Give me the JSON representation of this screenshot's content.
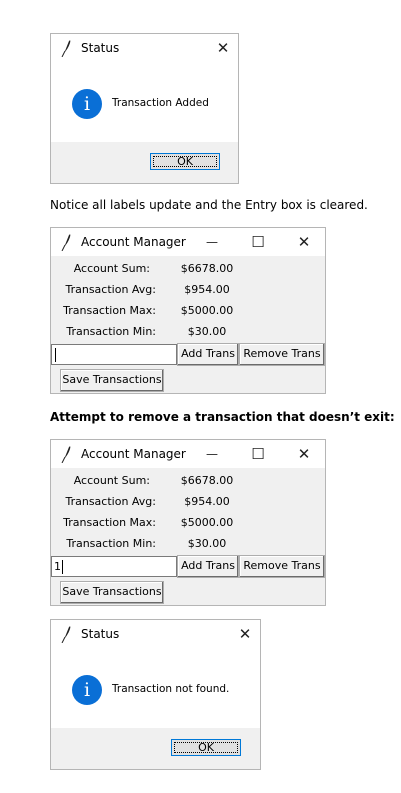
{
  "status_window_1": {
    "title": "Status",
    "close": "✕",
    "icon": "info-icon",
    "icon_glyph": "i",
    "message": "Transaction Added",
    "ok_label": "OK"
  },
  "caption_1": "Notice all labels update and the Entry box is cleared.",
  "account_window_1": {
    "title": "Account Manager",
    "minimize": "—",
    "maximize": "☐",
    "close": "✕",
    "rows": [
      {
        "label": "Account Sum:",
        "value": "$6678.00"
      },
      {
        "label": "Transaction Avg:",
        "value": "$954.00"
      },
      {
        "label": "Transaction Max:",
        "value": "$5000.00"
      },
      {
        "label": "Transaction Min:",
        "value": "$30.00"
      }
    ],
    "entry_value": "",
    "add_label": "Add Trans",
    "remove_label": "Remove Trans",
    "save_label": "Save Transactions"
  },
  "caption_2": "Attempt to remove a transaction that doesn’t exit:",
  "account_window_2": {
    "title": "Account Manager",
    "minimize": "—",
    "maximize": "☐",
    "close": "✕",
    "rows": [
      {
        "label": "Account Sum:",
        "value": "$6678.00"
      },
      {
        "label": "Transaction Avg:",
        "value": "$954.00"
      },
      {
        "label": "Transaction Max:",
        "value": "$5000.00"
      },
      {
        "label": "Transaction Min:",
        "value": "$30.00"
      }
    ],
    "entry_value": "1",
    "add_label": "Add Trans",
    "remove_label": "Remove Trans",
    "save_label": "Save Transactions"
  },
  "status_window_2": {
    "title": "Status",
    "close": "✕",
    "icon": "info-icon",
    "icon_glyph": "i",
    "message": "Transaction not found.",
    "ok_label": "OK"
  }
}
